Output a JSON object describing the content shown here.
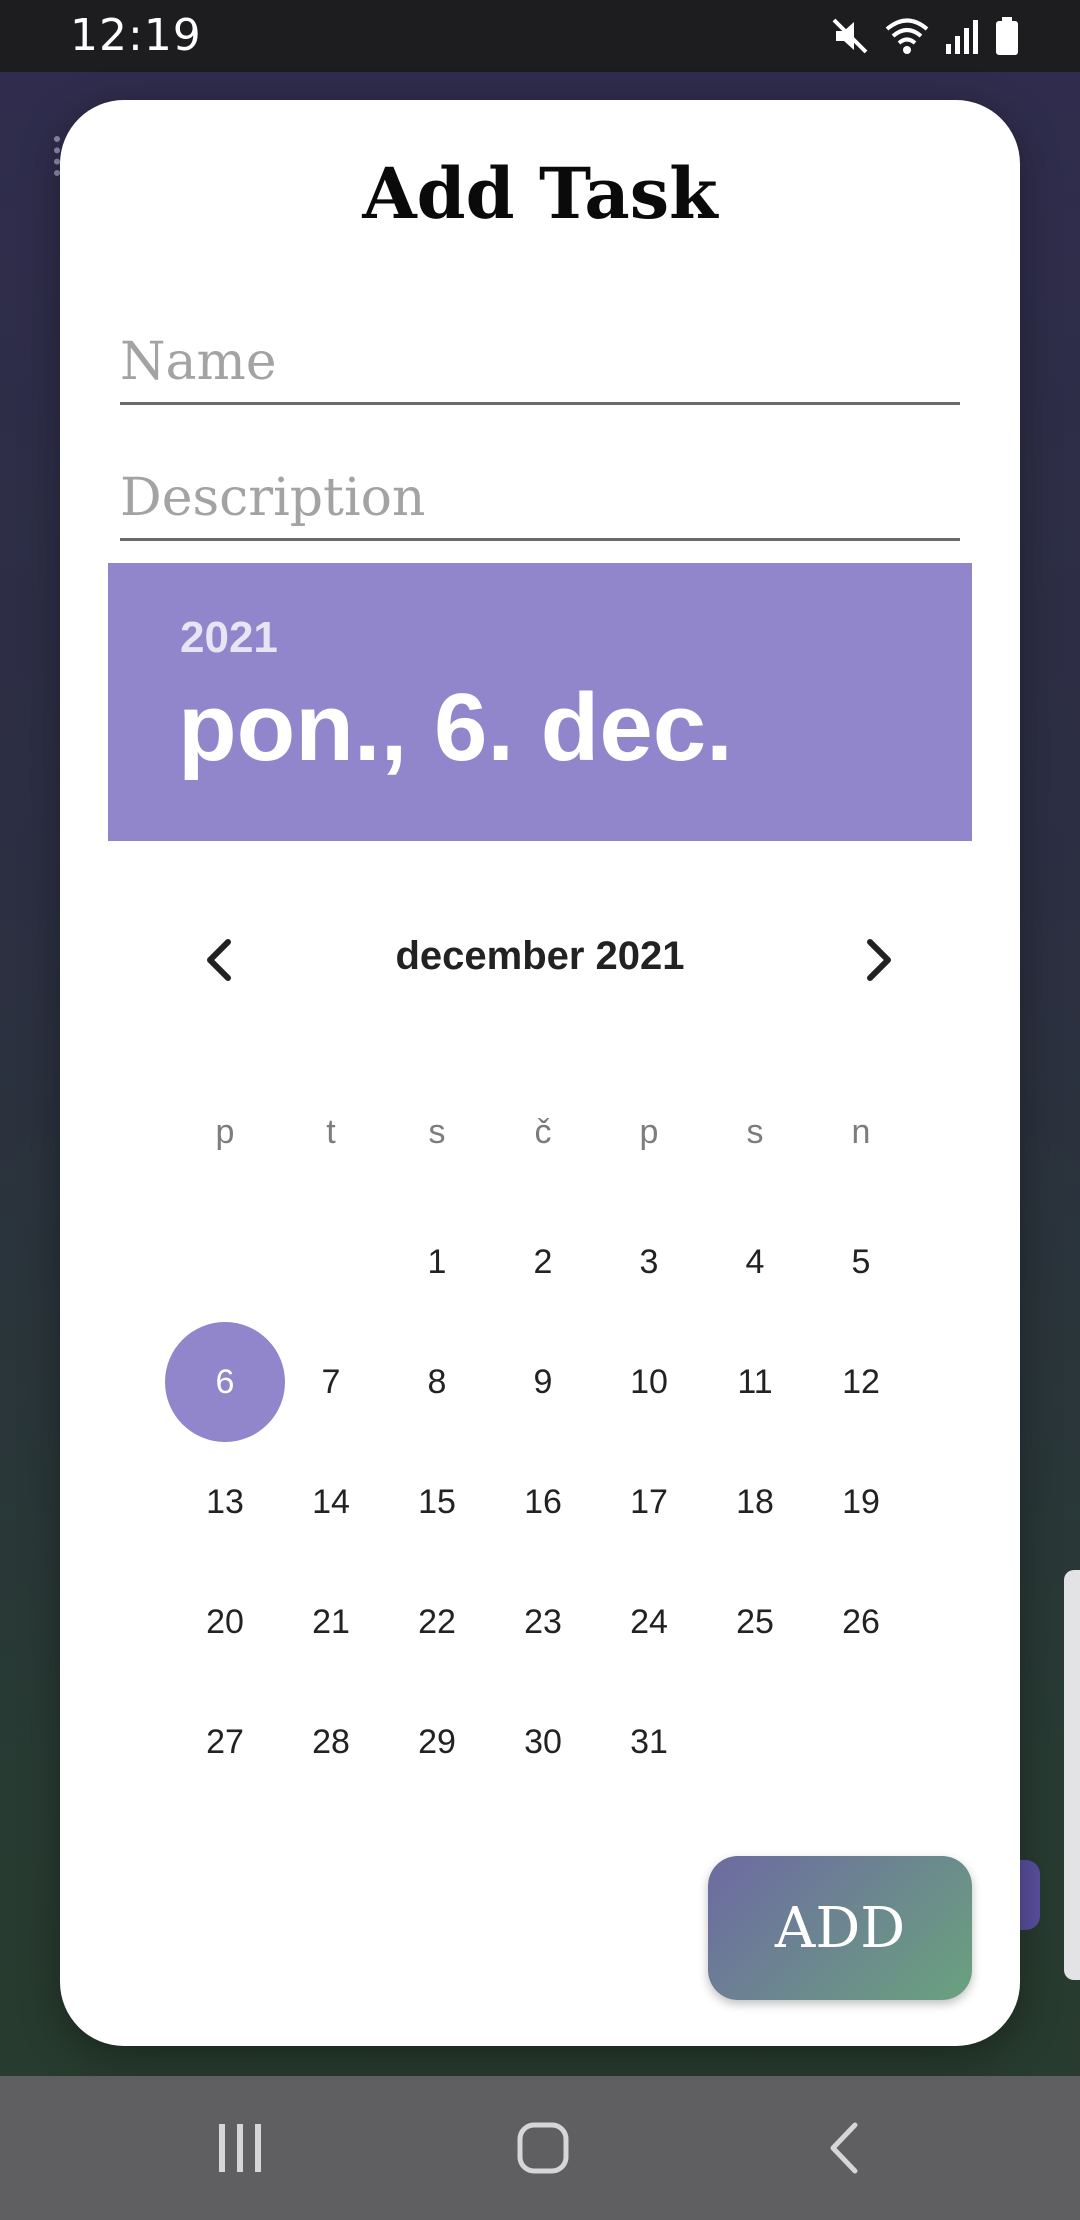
{
  "status_bar": {
    "time": "12:19",
    "icons": [
      "mute-icon",
      "wifi-icon",
      "signal-icon",
      "battery-icon"
    ]
  },
  "dialog": {
    "title": "Add Task",
    "name_field": {
      "placeholder": "Name",
      "value": ""
    },
    "description_field": {
      "placeholder": "Description",
      "value": ""
    },
    "date_picker": {
      "year": "2021",
      "selected_date": "pon., 6. dec.",
      "month_label": "december 2021",
      "weekdays": [
        "p",
        "t",
        "s",
        "č",
        "p",
        "s",
        "n"
      ],
      "weeks": [
        [
          "",
          "",
          "1",
          "2",
          "3",
          "4",
          "5"
        ],
        [
          "6",
          "7",
          "8",
          "9",
          "10",
          "11",
          "12"
        ],
        [
          "13",
          "14",
          "15",
          "16",
          "17",
          "18",
          "19"
        ],
        [
          "20",
          "21",
          "22",
          "23",
          "24",
          "25",
          "26"
        ],
        [
          "27",
          "28",
          "29",
          "30",
          "31",
          "",
          ""
        ]
      ],
      "selected_day": "6",
      "accent_color": "#9185cb"
    },
    "add_button_label": "ADD"
  },
  "nav_bar": {
    "buttons": [
      "recent-apps-icon",
      "home-icon",
      "back-icon"
    ]
  }
}
